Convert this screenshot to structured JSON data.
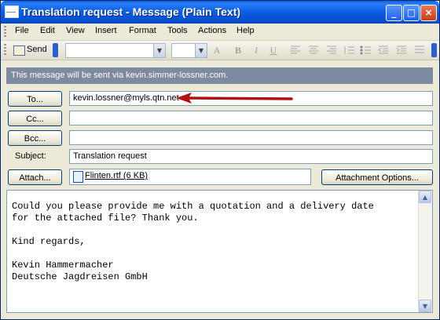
{
  "window": {
    "title": "Translation request - Message (Plain Text)",
    "controls": [
      "_",
      "□",
      "×"
    ]
  },
  "menu": [
    "File",
    "Edit",
    "View",
    "Insert",
    "Format",
    "Tools",
    "Actions",
    "Help"
  ],
  "toolbar": {
    "send_label": "Send",
    "font_name": "",
    "font_size": "",
    "format_glyphs": [
      "A",
      "B",
      "I",
      "U"
    ]
  },
  "info_bar": "This message will be sent via kevin.simmer-lossner.com.",
  "header": {
    "to_button": "To...",
    "to_value": "kevin.lossner@myls.qtn.net",
    "cc_button": "Cc...",
    "cc_value": "",
    "bcc_button": "Bcc...",
    "bcc_value": "",
    "subject_label": "Subject:",
    "subject_value": "Translation request",
    "attach_button": "Attach...",
    "attachment": "Flinten.rtf (6 KB)",
    "attachment_options_button": "Attachment Options..."
  },
  "body": "Could you please provide me with a quotation and a delivery date\nfor the attached file? Thank you.\n\nKind regards,\n\nKevin Hammermacher\nDeutsche Jagdreisen GmbH",
  "colors": {
    "arrow": "#b01010",
    "title_bar": "#0b5ce0",
    "info_bar": "#7e8aa0"
  }
}
